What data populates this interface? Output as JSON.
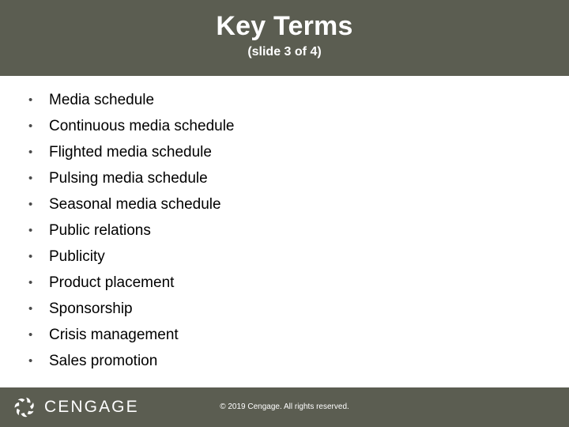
{
  "header": {
    "title": "Key Terms",
    "subtitle": "(slide 3 of 4)",
    "background_color": "#5b5d51",
    "text_color": "#ffffff"
  },
  "body": {
    "background_color": "#ffffff",
    "text_color": "#000000",
    "bullet_marker": "•",
    "bullets": [
      {
        "label": "Media schedule"
      },
      {
        "label": "Continuous media schedule"
      },
      {
        "label": "Flighted media schedule"
      },
      {
        "label": "Pulsing media schedule"
      },
      {
        "label": "Seasonal media schedule"
      },
      {
        "label": "Public relations"
      },
      {
        "label": "Publicity"
      },
      {
        "label": "Product placement"
      },
      {
        "label": "Sponsorship"
      },
      {
        "label": "Crisis management"
      },
      {
        "label": "Sales promotion"
      }
    ]
  },
  "footer": {
    "background_color": "#5b5d51",
    "logo_wordmark": "CENGAGE",
    "logo_mark_name": "cengage-burst-icon",
    "copyright": "© 2019 Cengage. All rights reserved."
  }
}
